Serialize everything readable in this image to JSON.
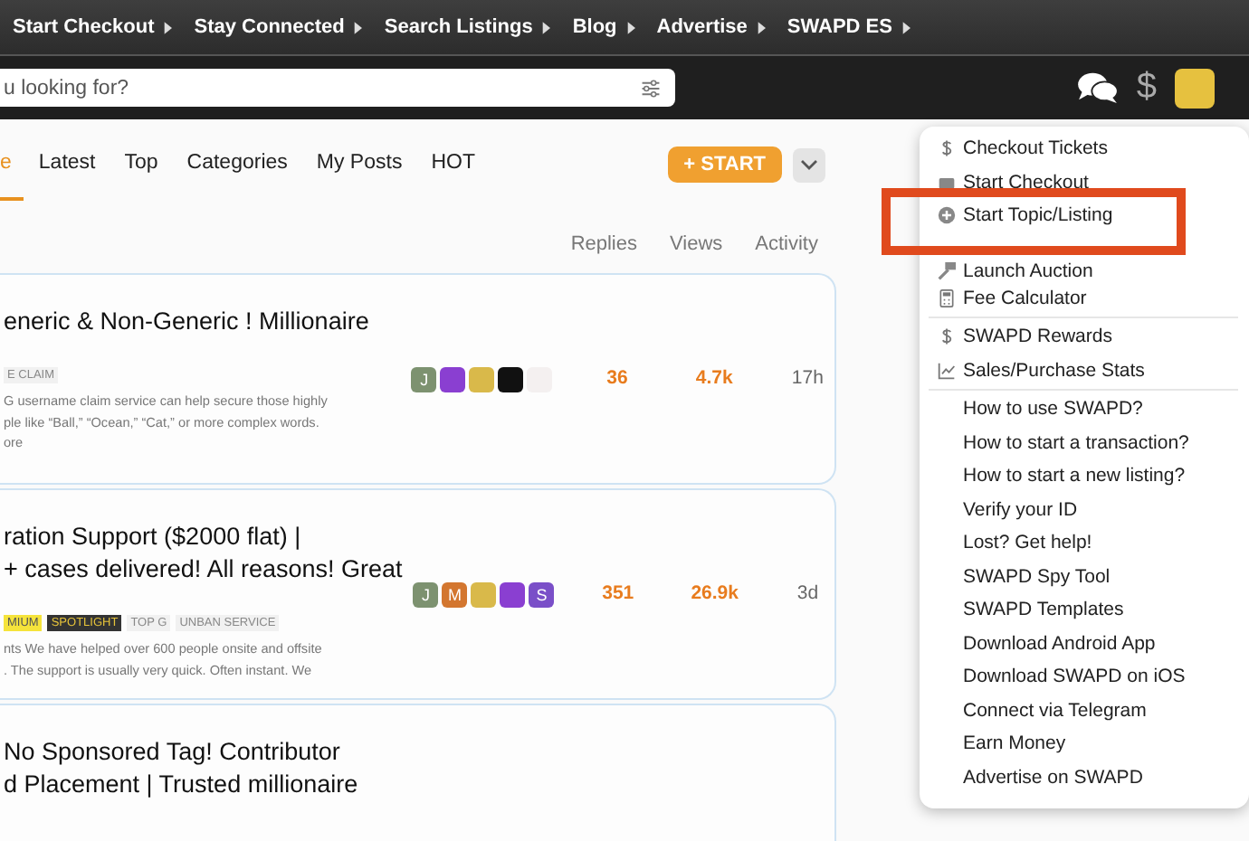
{
  "top_nav": [
    {
      "label": "Start Checkout"
    },
    {
      "label": "Stay Connected"
    },
    {
      "label": "Search Listings"
    },
    {
      "label": "Blog"
    },
    {
      "label": "Advertise"
    },
    {
      "label": "SWAPD ES"
    }
  ],
  "header": {
    "search": {
      "placeholder": "u looking for?"
    },
    "dollar": "$"
  },
  "tabs": [
    {
      "label": "e",
      "selected": true
    },
    {
      "label": "Latest",
      "selected": false
    },
    {
      "label": "Top",
      "selected": false
    },
    {
      "label": "Categories",
      "selected": false
    },
    {
      "label": "My Posts",
      "selected": false
    },
    {
      "label": "HOT",
      "selected": false
    }
  ],
  "start_button": "+ START",
  "columns": [
    "Replies",
    "Views",
    "Activity"
  ],
  "topics": [
    {
      "title": [
        "eneric & Non-Generic ! Millionaire"
      ],
      "tags": [
        {
          "label": "E CLAIM",
          "kind": "plain"
        }
      ],
      "excerpt": [
        "G username claim service can help secure those highly",
        "ple like “Ball,” “Ocean,” “Cat,” or more complex words.",
        "ore"
      ],
      "avatars": [
        {
          "letter": "J",
          "color": "#7d9270"
        },
        {
          "color": "#8a3fd1"
        },
        {
          "color": "#d9b94a"
        },
        {
          "color": "#111111"
        },
        {
          "color": "#f4f0f0"
        }
      ],
      "replies": "36",
      "views": "4.7k",
      "activity": "17h"
    },
    {
      "title": [
        "ration Support ($2000 flat) |",
        "+ cases delivered! All reasons! Great"
      ],
      "tags": [
        {
          "label": "MIUM",
          "kind": "yellow"
        },
        {
          "label": "SPOTLIGHT",
          "kind": "dark"
        },
        {
          "label": "TOP G",
          "kind": "plain"
        },
        {
          "label": "UNBAN SERVICE",
          "kind": "plain"
        }
      ],
      "excerpt": [
        "nts We have helped over 600 people onsite and offsite",
        ". The support is usually very quick. Often instant. We"
      ],
      "avatars": [
        {
          "letter": "J",
          "color": "#7d9270"
        },
        {
          "letter": "M",
          "color": "#d3762f"
        },
        {
          "color": "#d9b94a"
        },
        {
          "color": "#8a3fd1"
        },
        {
          "letter": "S",
          "color": "#7a4fc8"
        }
      ],
      "replies": "351",
      "views": "26.9k",
      "activity": "3d"
    },
    {
      "title": [
        "No Sponsored Tag! Contributor",
        "d Placement | Trusted millionaire"
      ]
    }
  ],
  "menu": {
    "sections": [
      [
        {
          "label": "Checkout Tickets",
          "kind": "dollar"
        },
        {
          "label": "Start Checkout",
          "kind": "checkout"
        },
        {
          "label": "Start Topic/Listing",
          "kind": "add"
        },
        {
          "label": "Launch Auction",
          "kind": "auction"
        },
        {
          "label": "Fee Calculator",
          "kind": "calculator"
        }
      ],
      [
        {
          "label": "SWAPD Rewards",
          "kind": "dollar"
        },
        {
          "label": "Sales/Purchase Stats",
          "kind": "chart"
        }
      ],
      [
        {
          "label": "How to use SWAPD?",
          "kind": "link"
        },
        {
          "label": "How to start a transaction?",
          "kind": "link"
        },
        {
          "label": "How to start a new listing?",
          "kind": "link"
        },
        {
          "label": "Verify your ID",
          "kind": "link"
        },
        {
          "label": "Lost? Get help!",
          "kind": "link"
        },
        {
          "label": "SWAPD Spy Tool",
          "kind": "link"
        },
        {
          "label": "SWAPD Templates",
          "kind": "link"
        },
        {
          "label": "Download Android App",
          "kind": "link"
        },
        {
          "label": "Download SWAPD on iOS",
          "kind": "link"
        },
        {
          "label": "Connect via Telegram",
          "kind": "link"
        },
        {
          "label": "Earn Money",
          "kind": "link"
        },
        {
          "label": "Advertise on SWAPD",
          "kind": "link"
        }
      ]
    ]
  }
}
